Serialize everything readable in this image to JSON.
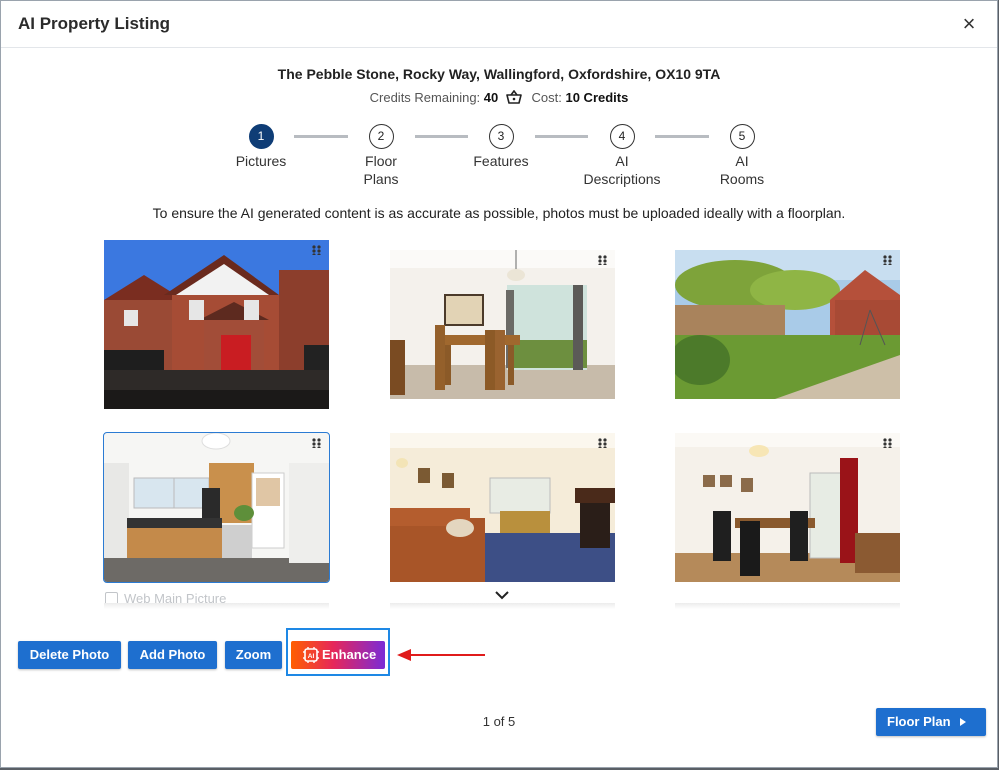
{
  "modal": {
    "title": "AI Property Listing",
    "close_glyph": "×"
  },
  "property": {
    "address": "The Pebble Stone, Rocky Way, Wallingford, Oxfordshire, OX10 9TA"
  },
  "credits": {
    "remaining_label": "Credits Remaining:",
    "remaining_value": "40",
    "cost_label": "Cost:",
    "cost_value": "10 Credits",
    "icon": "basket-icon"
  },
  "steps": [
    {
      "number": "1",
      "label": "Pictures",
      "active": true
    },
    {
      "number": "2",
      "label_line1": "Floor",
      "label_line2": "Plans",
      "active": false
    },
    {
      "number": "3",
      "label": "Features",
      "active": false
    },
    {
      "number": "4",
      "label_line1": "AI",
      "label_line2": "Descriptions",
      "active": false
    },
    {
      "number": "5",
      "label_line1": "AI",
      "label_line2": "Rooms",
      "active": false
    }
  ],
  "info_text": "To ensure the AI generated content is as accurate as possible, photos must be uploaded ideally with a floorplan.",
  "photos": [
    {
      "subject": "house exterior with red garage door"
    },
    {
      "subject": "dining room with patio doors"
    },
    {
      "subject": "garden with lawn and fence"
    },
    {
      "subject": "kitchen with wood cabinets",
      "selected": true
    },
    {
      "subject": "living room with brown sofa and fireplace"
    },
    {
      "subject": "dining room with red curtains"
    }
  ],
  "web_main_picture": {
    "label": "Web Main Picture",
    "checked": false
  },
  "actions": {
    "delete_label": "Delete Photo",
    "add_label": "Add Photo",
    "zoom_label": "Zoom",
    "enhance_label": "Enhance"
  },
  "pagination": {
    "text": "1 of 5"
  },
  "next_button": {
    "label": "Floor Plan"
  },
  "colors": {
    "primary_button": "#1e6fcf",
    "active_step": "#0f3d76",
    "highlight_box": "#1e88e5",
    "annotation_arrow": "#e01b1b"
  }
}
